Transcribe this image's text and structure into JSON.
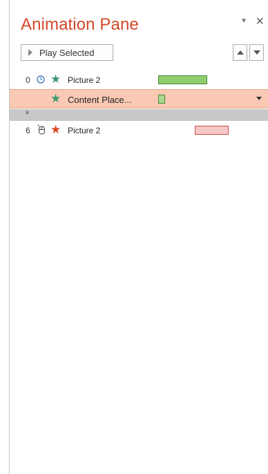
{
  "pane": {
    "title": "Animation Pane",
    "options_glyph": "▼",
    "close_glyph": "×"
  },
  "toolbar": {
    "play_label": "Play Selected"
  },
  "items": [
    {
      "order": "0",
      "trigger_icon": "clock-icon",
      "effect_icon": "star-icon",
      "effect_color": "#3c9a6e",
      "name": "Picture 2",
      "bar_color": "#8fcc70",
      "bar_border": "#4b8a36",
      "selected": false
    },
    {
      "order": "",
      "trigger_icon": "",
      "effect_icon": "star-icon",
      "effect_color": "#3c9a6e",
      "name": "Content Place...",
      "bar_color": "#a8d98f",
      "bar_border": "#4b8a36",
      "selected": true
    },
    {
      "order": "6",
      "trigger_icon": "mouse-icon",
      "effect_icon": "star-icon",
      "effect_color": "#d9441f",
      "name": "Picture 2",
      "bar_color": "#f8c9c9",
      "bar_border": "#c8494a",
      "selected": false
    }
  ],
  "expand_glyph": "»",
  "colors": {
    "accent": "#d24726",
    "selected_row": "#fac9b4",
    "expand_bar": "#c8c8c8"
  }
}
